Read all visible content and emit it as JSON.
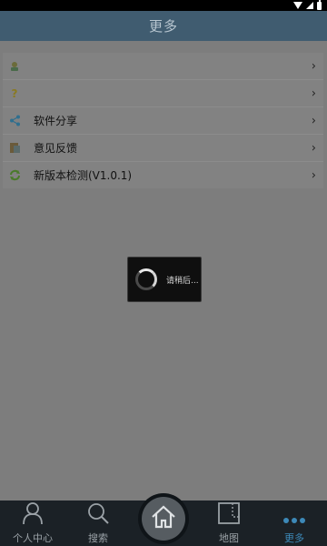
{
  "header": {
    "title": "更多"
  },
  "menu": {
    "items": [
      {
        "label": "",
        "icon": "user-icon"
      },
      {
        "label": "",
        "icon": "help-icon"
      },
      {
        "label": "软件分享",
        "icon": "share-icon"
      },
      {
        "label": "意见反馈",
        "icon": "feedback-icon"
      },
      {
        "label": "新版本检测(V1.0.1)",
        "icon": "update-icon"
      }
    ]
  },
  "loading": {
    "text": "请稍后..."
  },
  "tabs": [
    {
      "label": "个人中心",
      "icon": "person-icon"
    },
    {
      "label": "搜索",
      "icon": "search-icon"
    },
    {
      "label": "",
      "icon": "home-icon"
    },
    {
      "label": "地图",
      "icon": "map-icon"
    },
    {
      "label": "更多",
      "icon": "more-icon",
      "active": true
    }
  ],
  "colors": {
    "title_bar": "#405c70",
    "tab_bar": "#1b2126",
    "active_tab": "#3d89b8"
  }
}
